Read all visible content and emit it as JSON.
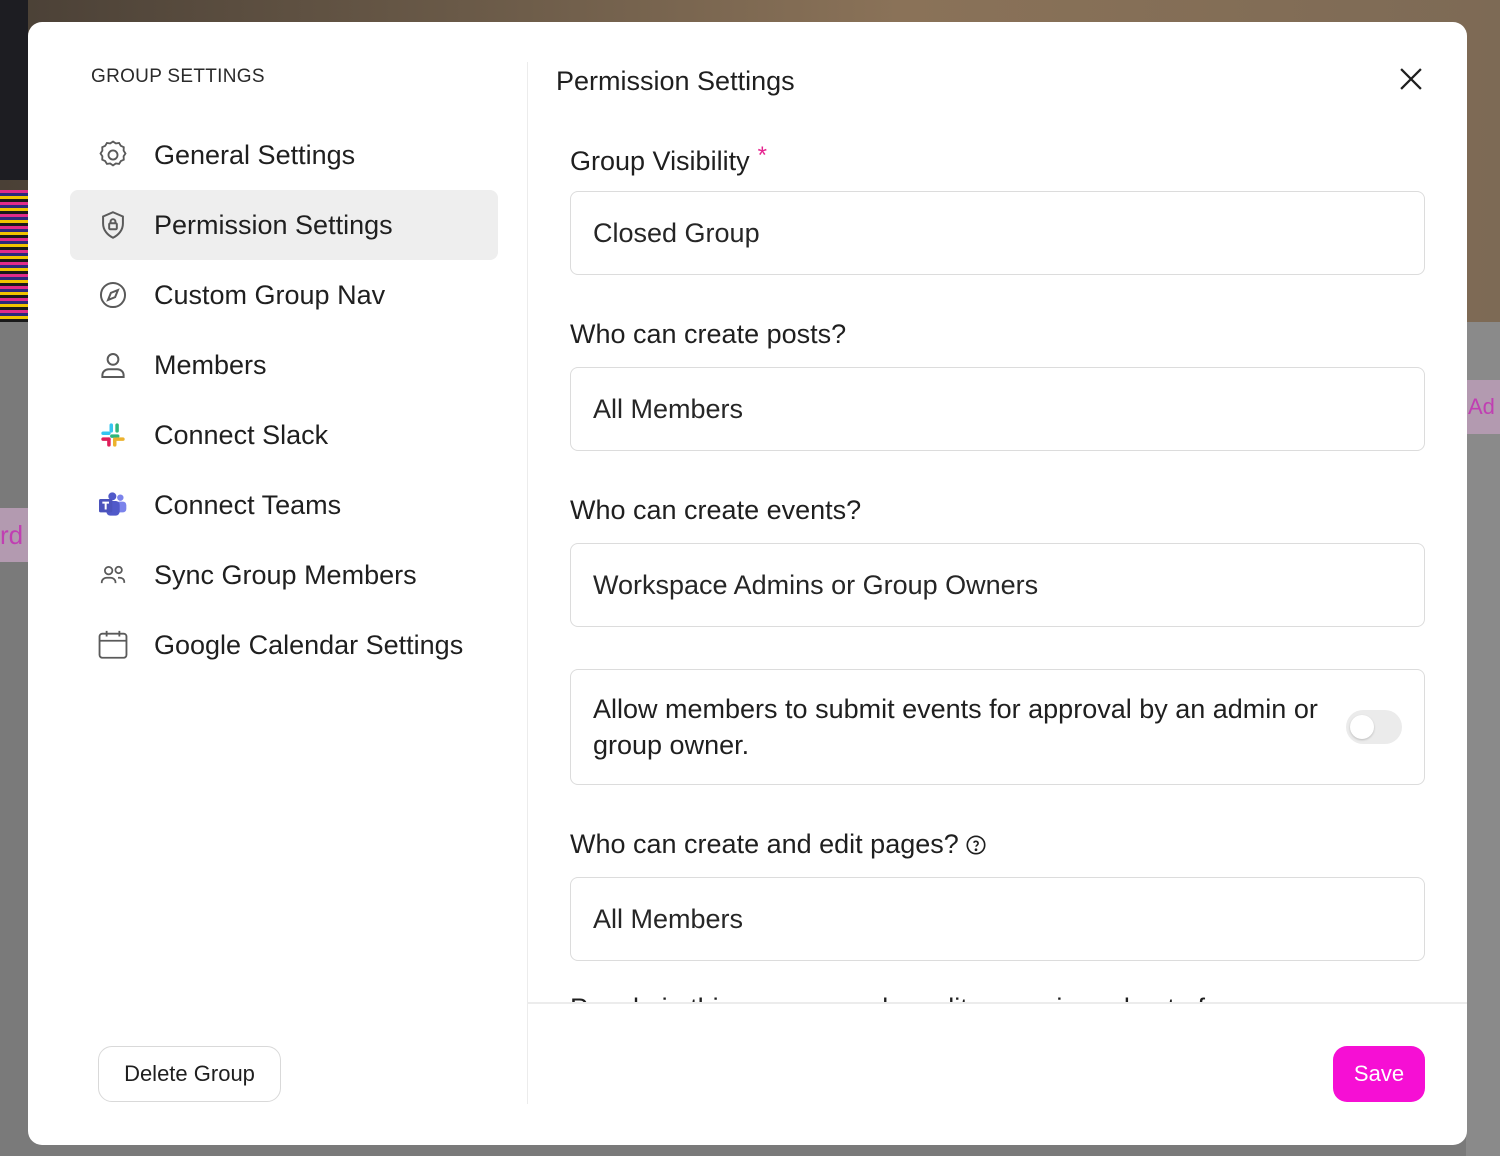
{
  "background": {
    "left_tab_text": "rd",
    "right_tab_text": "Ad"
  },
  "sidebar": {
    "title": "GROUP SETTINGS",
    "items": [
      {
        "label": "General Settings",
        "icon": "gear-icon",
        "active": false
      },
      {
        "label": "Permission Settings",
        "icon": "shield-lock-icon",
        "active": true
      },
      {
        "label": "Custom Group Nav",
        "icon": "compass-icon",
        "active": false
      },
      {
        "label": "Members",
        "icon": "user-icon",
        "active": false
      },
      {
        "label": "Connect Slack",
        "icon": "slack-icon",
        "active": false
      },
      {
        "label": "Connect Teams",
        "icon": "teams-icon",
        "active": false
      },
      {
        "label": "Sync Group Members",
        "icon": "users-icon",
        "active": false
      },
      {
        "label": "Google Calendar Settings",
        "icon": "calendar-icon",
        "active": false
      }
    ],
    "delete_label": "Delete Group"
  },
  "main": {
    "title": "Permission Settings",
    "fields": {
      "visibility": {
        "label": "Group Visibility",
        "required_mark": "*",
        "value": "Closed Group"
      },
      "posts": {
        "label": "Who can create posts?",
        "value": "All Members"
      },
      "events": {
        "label": "Who can create events?",
        "value": "Workspace Admins or Group Owners"
      },
      "submit_events": {
        "label": "Allow members to submit events for approval by an admin or group owner.",
        "enabled": false
      },
      "pages": {
        "label": "Who can create and edit pages?",
        "value": "All Members"
      },
      "cut_off": "People in this group can also edit pages in and out of groups"
    },
    "save_label": "Save"
  },
  "colors": {
    "accent": "#f60fd4",
    "required": "#e6248f",
    "active_nav_bg": "#eeeeee"
  }
}
